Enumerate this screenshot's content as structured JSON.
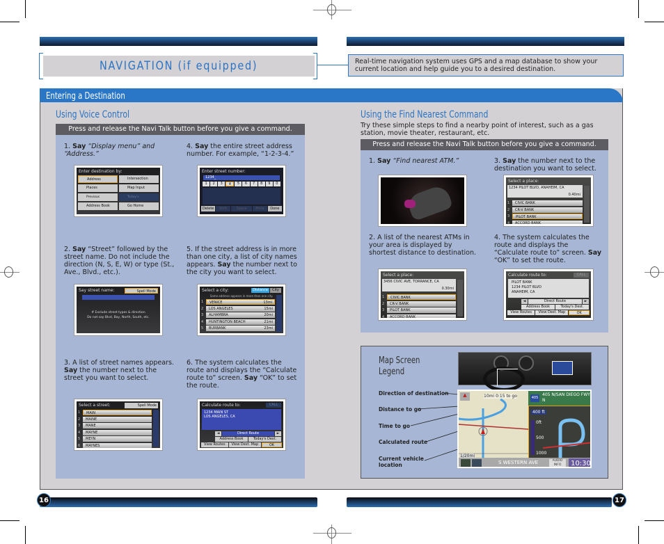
{
  "header": {
    "title": "NAVIGATION (if equipped)",
    "intro": "Real-time navigation system uses GPS and a map database to show your current location and help guide you to a desired destination."
  },
  "section": {
    "title": "Entering a Destination"
  },
  "voice": {
    "title": "Using Voice Control",
    "banner": "Press and release the Navi Talk button before you give a command.",
    "steps": [
      {
        "num": "1.",
        "say": "Say",
        "rest": " “Display menu” and “Address.”"
      },
      {
        "num": "4.",
        "say": "Say",
        "rest": " the entire street address number. For example, “1-2-3-4.”"
      },
      {
        "num": "2.",
        "say": "Say",
        "rest": " “Street” followed by the street name. Do not include the direction (N, S, E, W) or type (St., Ave., Blvd., etc.)."
      },
      {
        "num": "5.",
        "pre": "If the street address is in more than one city,  a list of city names appears. ",
        "say": "Say",
        "rest": " the number next to the city you want to select."
      },
      {
        "num": "3.",
        "pre": "A list of street names appears. ",
        "say": "Say",
        "rest": " the number next to the street you want to select."
      },
      {
        "num": "6.",
        "pre": "The system calculates the route and displays the “Calculate route to” screen. ",
        "say": "Say",
        "rest": " “OK” to set the route."
      }
    ],
    "screens": {
      "dest": {
        "header": "Enter destination by:",
        "buttons": [
          "Address",
          "Intersection",
          "Places",
          "Map Input",
          "Previous Destinations",
          "Today's Destinations",
          "Address Book",
          "Go Home"
        ]
      },
      "number": {
        "header": "Enter street number:",
        "value": "1234_",
        "keys": [
          "1",
          "2",
          "3",
          "4",
          "5",
          "6",
          "7",
          "8",
          "9",
          "0"
        ],
        "actions": [
          "Delete",
          "Shift",
          "Space",
          "More",
          "Done"
        ]
      },
      "street_name": {
        "header": "Say street name:",
        "mode": "Spell Mode",
        "hint1": "# Exclude street types & direction",
        "hint2": "Do not say Blvd, Bay, North, South, etc."
      },
      "city": {
        "header": "Select a city:",
        "sort_distance": "Distance",
        "sort_city": "City",
        "note": "Same address appears in more than one city.",
        "rows": [
          {
            "n": "1",
            "name": "VENICE",
            "dist": "13mi"
          },
          {
            "n": "2",
            "name": "LOS ANGELES",
            "dist": "15mi"
          },
          {
            "n": "3",
            "name": "ALHAMBRA",
            "dist": "20mi"
          },
          {
            "n": "4",
            "name": "HUNTINGTON BEACH",
            "dist": "21mi"
          },
          {
            "n": "5",
            "name": "BURBANK",
            "dist": "23mi"
          }
        ]
      },
      "street": {
        "header": "Select a street:",
        "mode": "Spell Mode",
        "rows": [
          "MAIN",
          "MAINE",
          "MANE",
          "MAYNE",
          "MEYN",
          "MAYNES"
        ]
      },
      "calc": {
        "header": "Calculate route to:",
        "call": "CALL",
        "line1": "1234 MAIN ST",
        "line2": "LOS ANGELES, CA",
        "method": "Direct Route",
        "addr_book": "Address Book",
        "today": "Today's Dest.",
        "view_routes": "View Routes",
        "view_dest": "View Dest. Map",
        "ok": "OK"
      }
    }
  },
  "nearest": {
    "title": "Using the Find Nearest Command",
    "intro": "Try these simple steps to find a nearby point of interest, such as a gas station, movie theater, restaurant, etc.",
    "banner": "Press and release the Navi Talk button before you give a command.",
    "steps": [
      {
        "num": "1.",
        "say": "Say",
        "rest": " “Find nearest ATM.”"
      },
      {
        "num": "3.",
        "say": "Say",
        "rest": " the number next to the destination you want to select."
      },
      {
        "num": "2.",
        "pre": "A list of the nearest ATMs in your area is displayed by shortest distance to destination.",
        "say": "",
        "rest": ""
      },
      {
        "num": "4.",
        "pre": "The system calculates the route and displays the “Calculate route to” screen. ",
        "say": "Say",
        "rest": " “OK” to set the route."
      }
    ],
    "screens": {
      "place3": {
        "header": "Select a place:",
        "address": "1234 PILOT BLVD, ANAHEIM, CA",
        "dist": "0.40mi",
        "rows": [
          "CIVIC BANK",
          "CR-V BANK",
          "PILOT BANK",
          "ACCORD BANK"
        ]
      },
      "place2": {
        "header": "Select a place:",
        "address": "3456 CIVIC AVE, TORRANCE, CA",
        "dist": "0.30mi",
        "rows": [
          "CIVIC BANK",
          "CR-V BANK",
          "PILOT BANK",
          "ACCORD BANK"
        ]
      },
      "calc": {
        "header": "Calculate route to:",
        "call": "CALL",
        "line1": "PILOT BANK",
        "line2": "1234 PILOT BLVD",
        "line3": "ANAHEIM, CA",
        "method": "Direct Route",
        "addr_book": "Address Book",
        "today": "Today's Dest.",
        "view_routes": "View Routes",
        "view_dest": "View Dest. Map",
        "ok": "OK"
      }
    }
  },
  "legend": {
    "title_line1": "Map Screen",
    "title_line2": "Legend",
    "labels": [
      "Direction of destination",
      "Distance to go",
      "Time to go",
      "Calculated route",
      "Current vehicle location"
    ],
    "map": {
      "distance": "10mi",
      "time": "0:15 to go",
      "freeway_shield": "405",
      "freeway": "405 N/SAN DIEGO FWY",
      "freeway_dir": "N",
      "turn_dist": "400 ft",
      "scale_marks": [
        "0ft",
        "500",
        "1000"
      ],
      "scale": "1/20mi",
      "street": "S WESTERN AVE",
      "audio": "AUDIO INFO",
      "clock": "10:30"
    }
  },
  "footer": {
    "page_left": "16",
    "page_right": "17"
  }
}
